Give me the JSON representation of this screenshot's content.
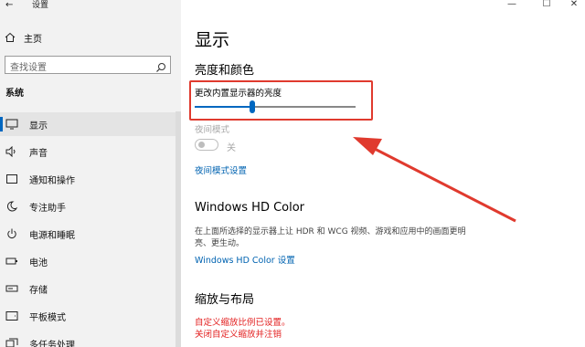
{
  "window": {
    "title": "设置",
    "back_glyph": "←",
    "minimize_glyph": "—",
    "maximize_glyph": "☐",
    "close_glyph": "✕"
  },
  "sidebar": {
    "home_label": "主页",
    "search_placeholder": "查找设置",
    "section_label": "系统",
    "items": [
      {
        "label": "显示",
        "icon": "monitor-icon",
        "active": true
      },
      {
        "label": "声音",
        "icon": "speaker-icon"
      },
      {
        "label": "通知和操作",
        "icon": "notification-icon"
      },
      {
        "label": "专注助手",
        "icon": "moon-icon"
      },
      {
        "label": "电源和睡眠",
        "icon": "power-icon"
      },
      {
        "label": "电池",
        "icon": "battery-icon"
      },
      {
        "label": "存储",
        "icon": "storage-icon"
      },
      {
        "label": "平板模式",
        "icon": "tablet-icon"
      },
      {
        "label": "多任务处理",
        "icon": "multitask-icon"
      }
    ]
  },
  "main": {
    "page_title": "显示",
    "brightness": {
      "heading": "亮度和颜色",
      "slider_label": "更改内置显示器的亮度",
      "slider_value": 0.36
    },
    "night_light": {
      "label": "夜间模式",
      "state": "关",
      "enabled": false,
      "settings_link": "夜间模式设置"
    },
    "hdr": {
      "heading": "Windows HD Color",
      "description": "在上面所选择的显示器上让 HDR 和 WCG 视频、游戏和应用中的画面更明亮、更生动。",
      "link": "Windows HD Color 设置"
    },
    "scale": {
      "heading": "缩放与布局",
      "custom_note": "自定义缩放比例已设置。",
      "disable_link": "关闭自定义缩放并注销"
    }
  },
  "colors": {
    "accent": "#0067c0",
    "annotation": "#e03a2e",
    "sidebar_bg": "#f2f2f2"
  }
}
